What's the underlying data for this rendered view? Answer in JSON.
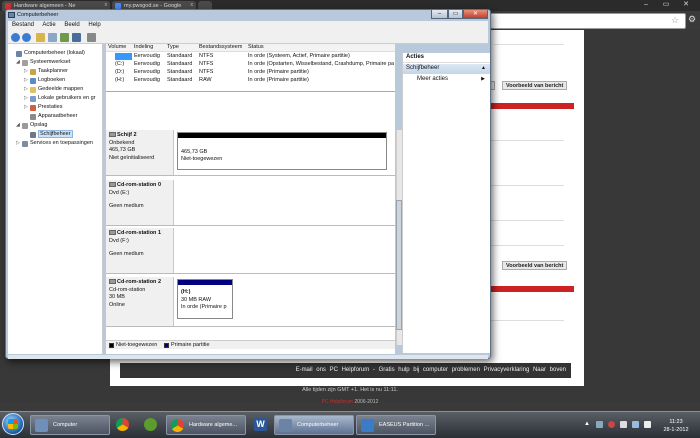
{
  "browser": {
    "tabs": [
      {
        "label": "Hardware algemeen - Ne"
      },
      {
        "label": "my.pwsgod.se - Google"
      }
    ],
    "tab_close": "x",
    "controls": {
      "minimize": "–",
      "maximize": "▭",
      "close": "✕"
    },
    "page": {
      "buttons": [
        "Voorbeeld van bericht",
        "Voorbeeld van bericht"
      ],
      "footer_text": "E-mail ons  PC Helpforum - Gratis hulp bij computer problemen  Privacyverklaring  Naar boven",
      "time_note": "Alle tijden zijn GMT +1. Het is nu 11:11.",
      "copyright_name": "PC Helpforum",
      "copyright_years": "2006-2012"
    }
  },
  "window": {
    "title": "Computerbeheer",
    "controls": {
      "minimize": "–",
      "maximize": "▭",
      "close": "✕"
    },
    "menu": [
      "Bestand",
      "Actie",
      "Beeld",
      "Help"
    ],
    "tree": [
      {
        "label": "Computerbeheer (lokaal)",
        "expander": "",
        "level": 0,
        "icon": "computer-management-icon"
      },
      {
        "label": "Systeemwerkset",
        "expander": "◢",
        "level": 1,
        "icon": "tools-icon"
      },
      {
        "label": "Taakplanner",
        "expander": "▷",
        "level": 2,
        "icon": "clock-icon"
      },
      {
        "label": "Logboeken",
        "expander": "▷",
        "level": 2,
        "icon": "event-viewer-icon"
      },
      {
        "label": "Gedeelde mappen",
        "expander": "▷",
        "level": 2,
        "icon": "shared-folder-icon"
      },
      {
        "label": "Lokale gebruikers en gr",
        "expander": "▷",
        "level": 2,
        "icon": "users-icon"
      },
      {
        "label": "Prestaties",
        "expander": "▷",
        "level": 2,
        "icon": "performance-icon"
      },
      {
        "label": "Apparaatbeheer",
        "expander": "",
        "level": 2,
        "icon": "device-manager-icon"
      },
      {
        "label": "Opslag",
        "expander": "◢",
        "level": 1,
        "icon": "storage-icon"
      },
      {
        "label": "Schijfbeheer",
        "expander": "",
        "level": 2,
        "icon": "disk-management-icon",
        "selected": true
      },
      {
        "label": "Services en toepassingen",
        "expander": "▷",
        "level": 1,
        "icon": "services-icon"
      }
    ],
    "volume_columns": [
      "Volume",
      "Indeling",
      "Type",
      "Bestandssysteem",
      "Status"
    ],
    "volumes": [
      {
        "volume": "",
        "indeling": "Eenvoudig",
        "type": "Standaard",
        "fs": "NTFS",
        "status": "In orde (Systeem, Actief, Primaire partitie)"
      },
      {
        "volume": "(C:)",
        "indeling": "Eenvoudig",
        "type": "Standaard",
        "fs": "NTFS",
        "status": "In orde (Opstarten, Wisselbestand, Crashdump, Primaire partitie)"
      },
      {
        "volume": "(D:)",
        "indeling": "Eenvoudig",
        "type": "Standaard",
        "fs": "NTFS",
        "status": "In orde (Primaire partitie)"
      },
      {
        "volume": "(H:)",
        "indeling": "Eenvoudig",
        "type": "Standaard",
        "fs": "RAW",
        "status": "In orde (Primaire partitie)"
      }
    ],
    "disks": [
      {
        "name": "Schijf 2",
        "lines": [
          "Onbekend",
          "465,73 GB",
          "Niet geïnitialiseerd"
        ],
        "partition": {
          "size": "465,73 GB",
          "status": "Niet-toegewezen",
          "label": ""
        }
      },
      {
        "name": "Cd-rom-station 0",
        "lines": [
          "Dvd (E:)",
          "",
          "Geen medium"
        ]
      },
      {
        "name": "Cd-rom-station 1",
        "lines": [
          "Dvd (F:)",
          "",
          "Geen medium"
        ]
      },
      {
        "name": "Cd-rom-station 2",
        "lines": [
          "Cd-rom-station",
          "30 MB",
          "Online"
        ],
        "partition": {
          "label": "(H:)",
          "size": "30 MB RAW",
          "status": "In orde (Primaire p"
        }
      }
    ],
    "legend": [
      "Niet-toegewezen",
      "Primaire partitie"
    ],
    "actions": {
      "header": "Acties",
      "section": "Schijfbeheer",
      "more": "Meer acties"
    }
  },
  "taskbar": {
    "buttons": [
      {
        "label": "Computer",
        "icon": "computer-icon"
      },
      {
        "label": "Hardware algeme...",
        "icon": "chrome-icon"
      },
      {
        "label": "Computerbeheer",
        "icon": "computer-management-icon",
        "active": true
      },
      {
        "label": "EASEUS Partition ...",
        "icon": "easeus-icon"
      }
    ],
    "pinned": [
      "chrome-icon",
      "utorrent-icon",
      "word-icon"
    ],
    "clock": {
      "time": "11:23",
      "date": "28-1-2012"
    },
    "tray_expand": "▲",
    "colors": {
      "accent": "#3399ff",
      "primary_partition": "#000080",
      "unallocated": "#000000"
    }
  }
}
